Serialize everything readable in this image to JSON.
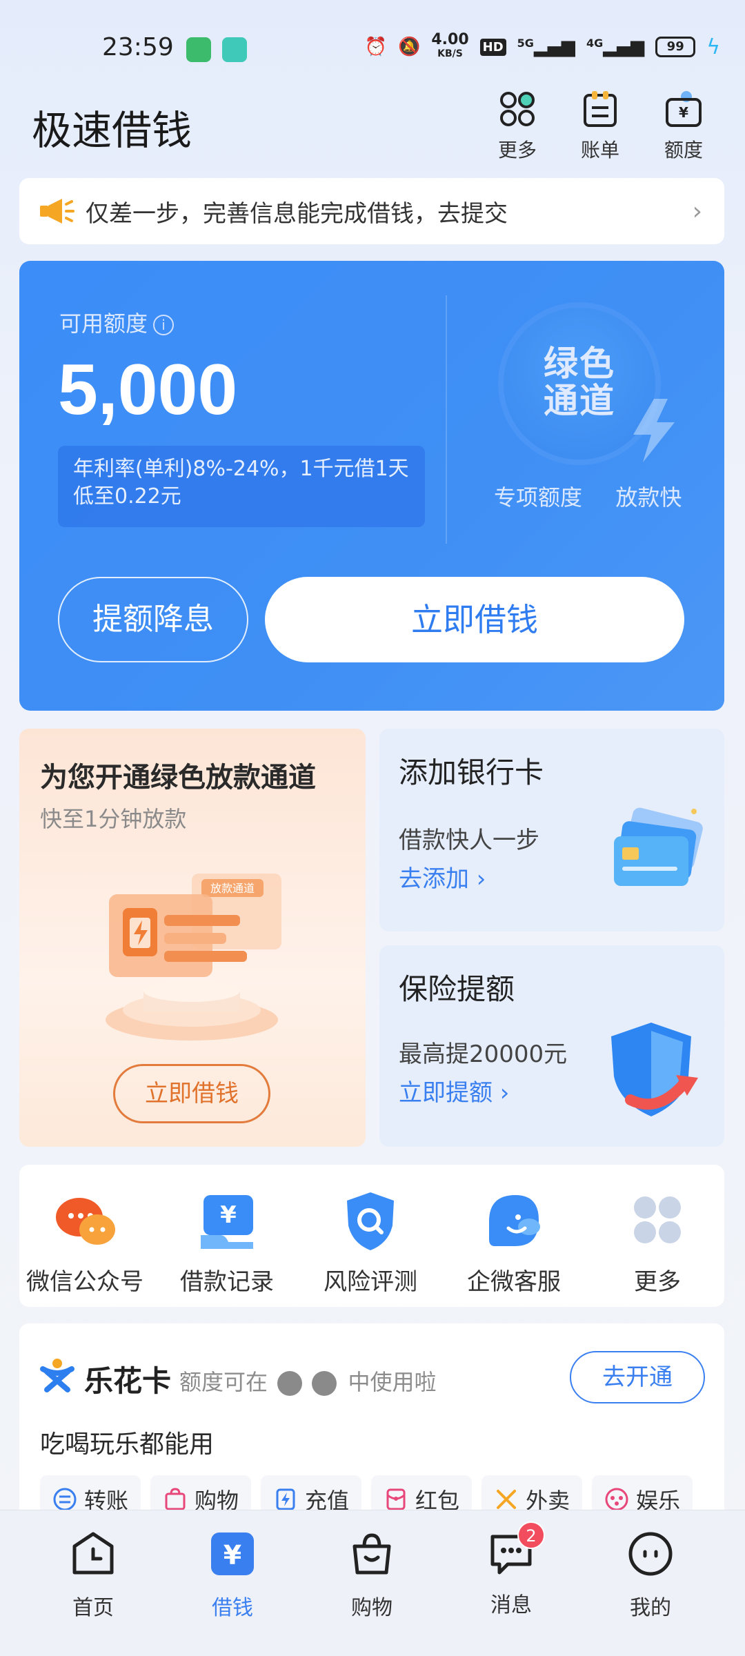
{
  "status_bar": {
    "time": "23:59",
    "speed_value": "4.00",
    "speed_unit": "KB/S",
    "hd": "HD",
    "net1": "5G",
    "net2": "4G",
    "battery": "99"
  },
  "header": {
    "title": "极速借钱",
    "actions": [
      {
        "label": "更多",
        "icon": "more-circles-icon"
      },
      {
        "label": "账单",
        "icon": "bill-icon"
      },
      {
        "label": "额度",
        "icon": "wallet-icon"
      }
    ]
  },
  "notice": {
    "text": "仅差一步，完善信息能完成借钱，去提交",
    "icon": "megaphone-icon"
  },
  "credit_card": {
    "label": "可用额度",
    "amount": "5,000",
    "rate_text": "年利率(单利)8%-24%，1千元借1天低至0.22元",
    "channel_title": "绿色通道",
    "channel_sub": "专项额度  放款快",
    "raise_button": "提额降息",
    "borrow_button": "立即借钱"
  },
  "promos": {
    "green": {
      "title": "为您开通绿色放款通道",
      "subtitle": "快至1分钟放款",
      "button": "立即借钱",
      "tag": "放款通道"
    },
    "bank": {
      "title": "添加银行卡",
      "subtitle": "借款快人一步",
      "link": "去添加 ›"
    },
    "insurance": {
      "title": "保险提额",
      "subtitle": "最高提20000元",
      "link": "立即提额 ›"
    }
  },
  "services": [
    {
      "label": "微信公众号",
      "icon": "wechat-icon"
    },
    {
      "label": "借款记录",
      "icon": "loan-record-icon"
    },
    {
      "label": "风险评测",
      "icon": "risk-assessment-icon"
    },
    {
      "label": "企微客服",
      "icon": "customer-service-icon"
    },
    {
      "label": "更多",
      "icon": "more-grid-icon"
    }
  ],
  "lehua": {
    "name": "乐花卡",
    "desc": "额度可在",
    "desc_tail": "中使用啦",
    "button": "去开通",
    "sub": "吃喝玩乐都能用",
    "chips": [
      {
        "label": "转账",
        "icon": "transfer-icon"
      },
      {
        "label": "购物",
        "icon": "shopping-bag-icon"
      },
      {
        "label": "充值",
        "icon": "recharge-icon"
      },
      {
        "label": "红包",
        "icon": "red-packet-icon"
      },
      {
        "label": "外卖",
        "icon": "takeout-icon"
      },
      {
        "label": "娱乐",
        "icon": "gamepad-icon"
      }
    ]
  },
  "bottom_nav": [
    {
      "label": "首页",
      "icon": "home-clock-icon"
    },
    {
      "label": "借钱",
      "icon": "yuan-icon",
      "active": true
    },
    {
      "label": "购物",
      "icon": "shopping-bag-icon"
    },
    {
      "label": "消息",
      "icon": "message-icon",
      "badge": "2"
    },
    {
      "label": "我的",
      "icon": "profile-icon"
    }
  ],
  "colors": {
    "primary_blue": "#3c8df7",
    "link_blue": "#3a7ff0",
    "orange": "#e0722c",
    "badge_red": "#f24c5f"
  }
}
